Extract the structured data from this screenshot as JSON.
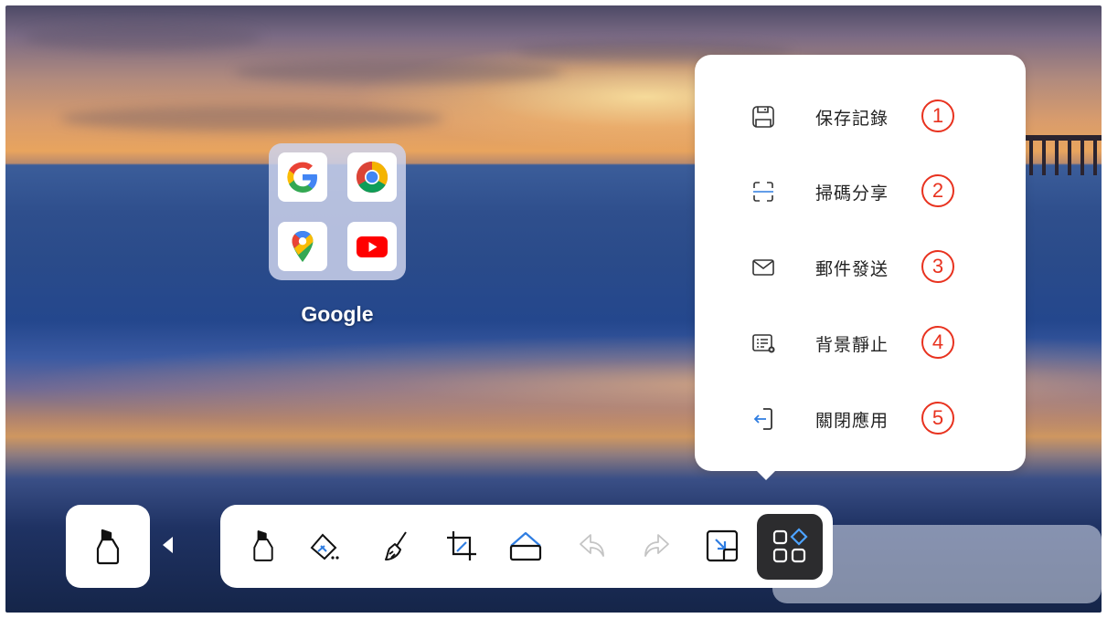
{
  "desktop": {
    "folder": {
      "label": "Google",
      "apps": [
        {
          "name": "Google",
          "icon": "google-icon"
        },
        {
          "name": "Chrome",
          "icon": "chrome-icon"
        },
        {
          "name": "Maps",
          "icon": "maps-icon"
        },
        {
          "name": "YouTube",
          "icon": "youtube-icon"
        }
      ]
    }
  },
  "menu": {
    "items": [
      {
        "label": "保存記錄",
        "number": "1",
        "icon": "save-icon"
      },
      {
        "label": "掃碼分享",
        "number": "2",
        "icon": "scan-icon"
      },
      {
        "label": "郵件發送",
        "number": "3",
        "icon": "mail-icon"
      },
      {
        "label": "背景靜止",
        "number": "4",
        "icon": "background-freeze-icon"
      },
      {
        "label": "關閉應用",
        "number": "5",
        "icon": "exit-icon"
      }
    ],
    "number_color": "#e8321f",
    "exit_icon_color": "#2f7de1"
  },
  "toolbar": {
    "current_tool": "marker-icon",
    "tools": [
      "marker-icon",
      "eraser-icon",
      "brush-icon",
      "crop-icon",
      "shape-icon",
      "undo-icon",
      "redo-icon",
      "minimize-icon",
      "apps-menu-icon"
    ],
    "active_tool": "apps-menu-icon",
    "accent": "#2f7de1"
  }
}
